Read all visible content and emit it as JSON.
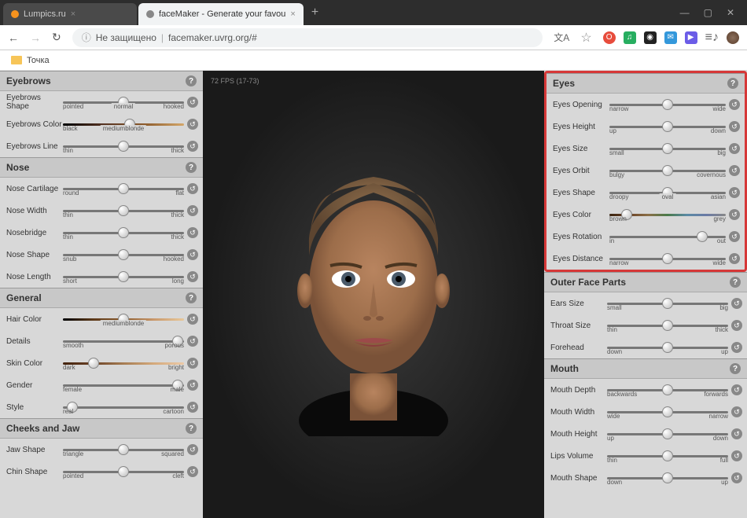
{
  "tabs": [
    {
      "title": "Lumpics.ru",
      "active": false,
      "icon": "#f7931e"
    },
    {
      "title": "faceMaker - Generate your favou",
      "active": true,
      "icon": "#888"
    }
  ],
  "address": {
    "security": "Не защищено",
    "url": "facemaker.uvrg.org/#"
  },
  "bookmark": "Точка",
  "fps": "72 FPS (17-73)",
  "left": [
    {
      "title": "Eyebrows",
      "sliders": [
        {
          "label": "Eyebrows Shape",
          "min": "pointed",
          "max": "hooked",
          "mid": "normal",
          "pos": 50
        },
        {
          "label": "Eyebrows Color",
          "min": "black",
          "max": "",
          "mid": "mediumblonde",
          "pos": 55,
          "color": "color-eb"
        },
        {
          "label": "Eyebrows Line",
          "min": "thin",
          "max": "thick",
          "pos": 50
        }
      ]
    },
    {
      "title": "Nose",
      "sliders": [
        {
          "label": "Nose Cartilage",
          "min": "round",
          "max": "flat",
          "pos": 50
        },
        {
          "label": "Nose Width",
          "min": "thin",
          "max": "thick",
          "pos": 50
        },
        {
          "label": "Nosebridge",
          "min": "thin",
          "max": "thick",
          "pos": 50
        },
        {
          "label": "Nose Shape",
          "min": "snub",
          "max": "hooked",
          "pos": 50
        },
        {
          "label": "Nose Length",
          "min": "short",
          "max": "long",
          "pos": 50
        }
      ]
    },
    {
      "title": "General",
      "sliders": [
        {
          "label": "Hair Color",
          "min": "",
          "max": "",
          "mid": "mediumblonde",
          "pos": 50,
          "color": "color-hair"
        },
        {
          "label": "Details",
          "min": "smooth",
          "max": "porous",
          "pos": 95
        },
        {
          "label": "Skin Color",
          "min": "dark",
          "max": "bright",
          "pos": 25,
          "color": "color-skin"
        },
        {
          "label": "Gender",
          "min": "female",
          "max": "male",
          "pos": 95
        },
        {
          "label": "Style",
          "min": "real",
          "max": "cartoon",
          "pos": 8
        }
      ]
    },
    {
      "title": "Cheeks and Jaw",
      "sliders": [
        {
          "label": "Jaw Shape",
          "min": "triangle",
          "max": "squared",
          "pos": 50
        },
        {
          "label": "Chin Shape",
          "min": "pointed",
          "max": "cleft",
          "pos": 50
        }
      ]
    }
  ],
  "right": [
    {
      "title": "Eyes",
      "highlight": true,
      "sliders": [
        {
          "label": "Eyes Opening",
          "min": "narrow",
          "max": "wide",
          "pos": 50
        },
        {
          "label": "Eyes Height",
          "min": "up",
          "max": "down",
          "pos": 50
        },
        {
          "label": "Eyes Size",
          "min": "small",
          "max": "big",
          "pos": 50
        },
        {
          "label": "Eyes Orbit",
          "min": "bulgy",
          "max": "covernous",
          "pos": 50
        },
        {
          "label": "Eyes Shape",
          "min": "droopy",
          "max": "asian",
          "mid": "oval",
          "pos": 50
        },
        {
          "label": "Eyes Color",
          "min": "brown",
          "max": "grey",
          "pos": 15,
          "color": "color-eye"
        },
        {
          "label": "Eyes Rotation",
          "min": "in",
          "max": "out",
          "pos": 80
        },
        {
          "label": "Eyes Distance",
          "min": "narrow",
          "max": "wide",
          "pos": 50
        }
      ]
    },
    {
      "title": "Outer Face Parts",
      "sliders": [
        {
          "label": "Ears Size",
          "min": "small",
          "max": "big",
          "pos": 50
        },
        {
          "label": "Throat Size",
          "min": "thin",
          "max": "thick",
          "pos": 50
        },
        {
          "label": "Forehead",
          "min": "down",
          "max": "up",
          "pos": 50
        }
      ]
    },
    {
      "title": "Mouth",
      "sliders": [
        {
          "label": "Mouth Depth",
          "min": "backwards",
          "max": "forwards",
          "pos": 50
        },
        {
          "label": "Mouth Width",
          "min": "wide",
          "max": "narrow",
          "pos": 50
        },
        {
          "label": "Mouth Height",
          "min": "up",
          "max": "down",
          "pos": 50
        },
        {
          "label": "Lips Volume",
          "min": "thin",
          "max": "full",
          "pos": 50
        },
        {
          "label": "Mouth Shape",
          "min": "down",
          "max": "up",
          "pos": 50
        }
      ]
    }
  ]
}
